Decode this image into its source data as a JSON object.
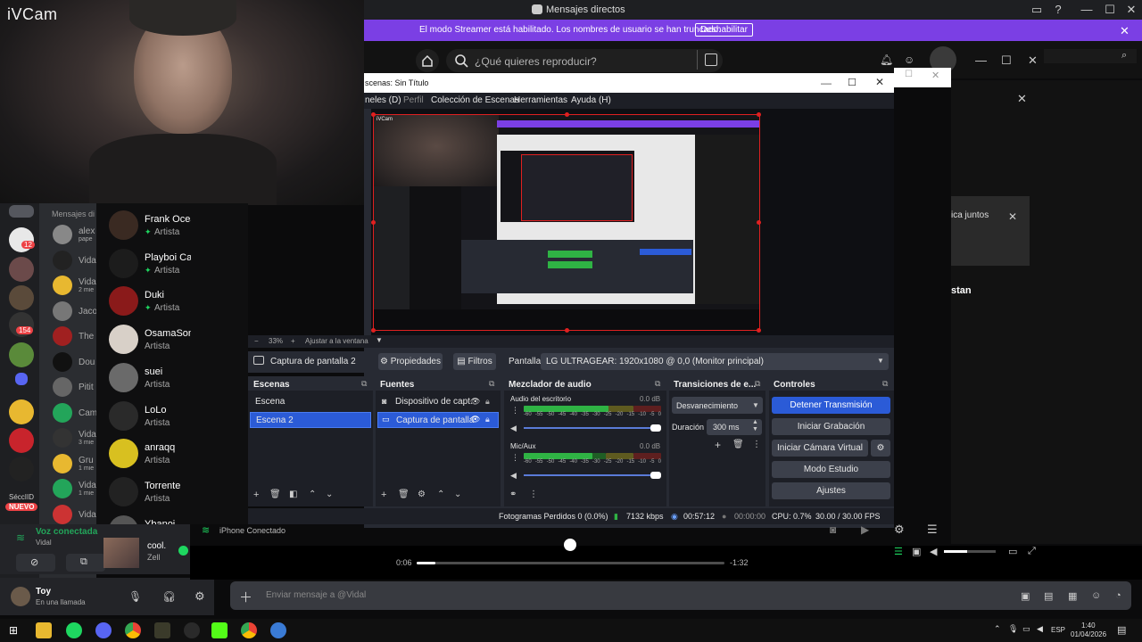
{
  "camera": {
    "label": "iVCam"
  },
  "discord": {
    "top_title": "Mensajes directos",
    "banner_text": "El modo Streamer está habilitado. Los nombres de usuario se han truncado.",
    "banner_button": "Deshabilitar",
    "dm_header": "Mensajes di",
    "dm_items": [
      {
        "name": "alex",
        "sub": "pape"
      },
      {
        "name": "Vida"
      },
      {
        "name": "Vida",
        "sub": "2 mie"
      },
      {
        "name": "Jaco"
      },
      {
        "name": "The"
      },
      {
        "name": "Dou"
      },
      {
        "name": "Pitit"
      },
      {
        "name": "Cam"
      },
      {
        "name": "Vida",
        "sub": "3 mie"
      },
      {
        "name": "Gru",
        "sub": "1 mie"
      },
      {
        "name": "Vida",
        "sub": "1 mie"
      },
      {
        "name": "Vida"
      }
    ],
    "guild_badges": [
      "12",
      "154",
      "NUEVO"
    ],
    "guild_label": "SéccIID",
    "voice_status": "Voz conectada",
    "voice_channel": "Vidal",
    "user_name": "Toy",
    "user_status": "En una llamada",
    "message_placeholder": "Enviar mensaje a @Vidal"
  },
  "spotify": {
    "search_placeholder": "¿Qué quieres reproducir?",
    "artists": [
      {
        "name": "Frank Ocean",
        "sub": "Artista",
        "verified": true
      },
      {
        "name": "Playboi Carti",
        "sub": "Artista",
        "verified": true
      },
      {
        "name": "Duki",
        "sub": "Artista",
        "verified": true
      },
      {
        "name": "OsamaSon",
        "sub": "Artista",
        "verified": false
      },
      {
        "name": "suei",
        "sub": "Artista",
        "verified": false
      },
      {
        "name": "LoLo",
        "sub": "Artista",
        "verified": false
      },
      {
        "name": "anraqq",
        "sub": "Artista",
        "verified": false
      },
      {
        "name": "Torrente",
        "sub": "Artista",
        "verified": false
      },
      {
        "name": "Ybanoi",
        "sub": "",
        "verified": false
      }
    ],
    "now_playing_title": "cool.",
    "now_playing_artist": "Zell",
    "elapsed": "0:06",
    "remaining": "-1:32",
    "device": "iPhone Conectado",
    "right_card_text": "ica juntos",
    "right_label": "stan",
    "progress_fraction": 0.06
  },
  "obs": {
    "title": "scenas: Sin Título",
    "menu": [
      "neles (D)",
      "Perfil",
      "Colección de Escenas",
      "Herramientas",
      "Ayuda (H)"
    ],
    "zoom": "33%",
    "fit_label": "Ajustar a la ventana",
    "source_name": "Captura de pantalla 2",
    "properties_btn": "Propiedades",
    "filters_btn": "Filtros",
    "screen_label": "Pantalla",
    "screen_value": "LG ULTRAGEAR: 1920x1080 @ 0,0 (Monitor principal)",
    "docks": {
      "scenes_title": "Escenas",
      "scenes": [
        "Escena",
        "Escena 2"
      ],
      "sources_title": "Fuentes",
      "sources": [
        "Dispositivo de capt.",
        "Captura de pantalla"
      ],
      "mixer_title": "Mezclador de audio",
      "mixer": [
        {
          "name": "Audio del escritorio",
          "db": "0.0 dB",
          "level": 0.62
        },
        {
          "name": "Mic/Aux",
          "db": "0.0 dB",
          "level": 0.5
        }
      ],
      "mixer_scale": [
        "-60",
        "-55",
        "-50",
        "-45",
        "-40",
        "-35",
        "-30",
        "-25",
        "-20",
        "-15",
        "-10",
        "-5",
        "0"
      ],
      "transitions_title": "Transiciones de e...",
      "transition_value": "Desvanecimiento",
      "duration_label": "Duración",
      "duration_value": "300 ms",
      "controls_title": "Controles",
      "controls": [
        "Detener Transmisión",
        "Iniciar Grabación",
        "Iniciar Cámara Virtual",
        "Modo Estudio",
        "Ajustes"
      ]
    },
    "status": {
      "dropped": "Fotogramas Perdidos 0 (0.0%)",
      "bitrate": "7132 kbps",
      "stream_time": "00:57:12",
      "rec_time": "00:00:00",
      "cpu": "CPU: 0.7%",
      "fps": "30.00 / 30.00 FPS"
    }
  },
  "taskbar": {
    "lang": "ESP",
    "time": "1:40",
    "date": "01/04/2026"
  },
  "colors": {
    "discord_purple": "#7b3fe4",
    "obs_selected": "#2b5bd7",
    "spotify_green": "#1ed760",
    "recording_red": "#e02020"
  }
}
